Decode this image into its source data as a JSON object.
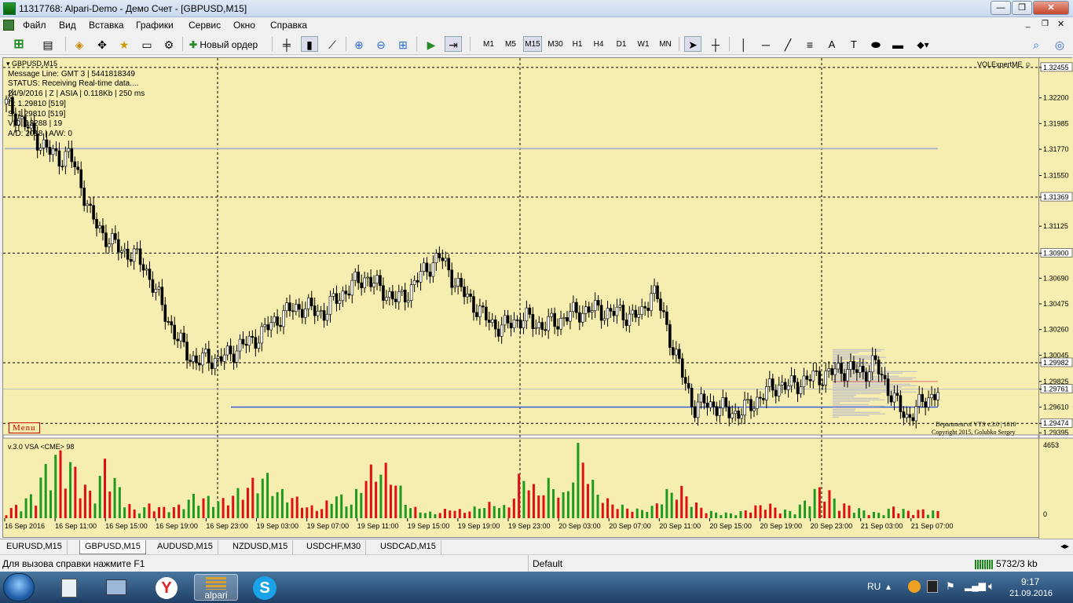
{
  "window": {
    "title": "11317768: Alpari-Demo - Демо Счет - [GBPUSD,M15]"
  },
  "menu": {
    "items": [
      "Файл",
      "Вид",
      "Вставка",
      "Графики",
      "Сервис",
      "Окно",
      "Справка"
    ]
  },
  "toolbar": {
    "new_order": "Новый ордер",
    "timeframes": [
      "M1",
      "M5",
      "M15",
      "M30",
      "H1",
      "H4",
      "D1",
      "W1",
      "MN"
    ],
    "active_timeframe": "M15"
  },
  "chart": {
    "symbol_title": "GBPUSD,M15",
    "info_lines": [
      "Message Line: GMT 3 | 5441818349",
      "STATUS: Receiving Real-time data....",
      "24/9/2016 | Z | ASIA | 0.118Kb | 250 ms",
      "D: 1.29810 [519]",
      "S: 1.29810 [519]",
      "V|D: 12288 | 19",
      "A/D: 2018 | A/W: 0"
    ],
    "expert_label": "VOLExpertME",
    "menu_badge": "Menu",
    "copyright_1": "Department of VTS  v.3.0 | 1010",
    "copyright_2": "Copyright 2015, Golubko Sergey",
    "volume_indicator": "v.3.0 VSA <CME> 98",
    "volume_max": "4653",
    "volume_zero": "0",
    "price_labels": [
      "1.32455",
      "1.32200",
      "1.31985",
      "1.31770",
      "1.31550",
      "1.31369",
      "1.31125",
      "1.30900",
      "1.30690",
      "1.30475",
      "1.30260",
      "1.30045",
      "1.29982",
      "1.29825",
      "1.29761",
      "1.29610",
      "1.29474",
      "1.29395"
    ],
    "highlighted_prices": [
      "1.32455",
      "1.31369",
      "1.30900",
      "1.29982",
      "1.29761",
      "1.29474"
    ],
    "time_labels": [
      "16 Sep 2016",
      "16 Sep 11:00",
      "16 Sep 15:00",
      "16 Sep 19:00",
      "16 Sep 23:00",
      "19 Sep 03:00",
      "19 Sep 07:00",
      "19 Sep 11:00",
      "19 Sep 15:00",
      "19 Sep 19:00",
      "19 Sep 23:00",
      "20 Sep 03:00",
      "20 Sep 07:00",
      "20 Sep 11:00",
      "20 Sep 15:00",
      "20 Sep 19:00",
      "20 Sep 23:00",
      "21 Sep 03:00",
      "21 Sep 07:00"
    ]
  },
  "chart_data": {
    "type": "candlestick",
    "title": "GBPUSD,M15",
    "ylim": [
      1.2939,
      1.3252
    ],
    "x_start": "16 Sep 2016",
    "x_end": "21 Sep 07:00",
    "close_path": [
      1.3215,
      1.3205,
      1.3195,
      1.3185,
      1.3175,
      1.317,
      1.3172,
      1.315,
      1.312,
      1.3108,
      1.3098,
      1.3092,
      1.3088,
      1.308,
      1.306,
      1.304,
      1.302,
      1.3008,
      1.2998,
      1.3003,
      1.3,
      1.3005,
      1.3012,
      1.3015,
      1.3022,
      1.303,
      1.3038,
      1.3043,
      1.3045,
      1.3042,
      1.304,
      1.305,
      1.3058,
      1.3065,
      1.307,
      1.3062,
      1.3056,
      1.305,
      1.3058,
      1.307,
      1.308,
      1.3087,
      1.3072,
      1.3058,
      1.3049,
      1.3038,
      1.303,
      1.3028,
      1.3033,
      1.3036,
      1.303,
      1.303,
      1.3032,
      1.3038,
      1.304,
      1.3043,
      1.3042,
      1.304,
      1.304,
      1.3037,
      1.3038,
      1.306,
      1.304,
      1.301,
      1.2985,
      1.296,
      1.2965,
      1.2962,
      1.2958,
      1.2956,
      1.296,
      1.2968,
      1.2975,
      1.298,
      1.2978,
      1.2982,
      1.2985,
      1.2987,
      1.299,
      1.2993,
      1.2992,
      1.299,
      1.2998,
      1.2982,
      1.2965,
      1.2952,
      1.296,
      1.2968,
      1.2975
    ],
    "volume_path": [
      400,
      900,
      1500,
      3500,
      3800,
      2600,
      1300,
      3500,
      1500,
      400,
      800,
      600,
      700,
      1300,
      1200,
      1000,
      1500,
      2000,
      2600,
      1600,
      1300,
      700,
      600,
      1500,
      800,
      2500,
      3100,
      2600,
      800,
      400,
      300,
      600,
      400,
      700,
      900,
      600,
      2800,
      1500,
      2200,
      1200,
      4400,
      1800,
      1000,
      700,
      500,
      600,
      1500,
      1800,
      900,
      400,
      300,
      300,
      600,
      900,
      500,
      400,
      1300,
      2000,
      900,
      700,
      400,
      300,
      700,
      400,
      500,
      400
    ],
    "horizontal_levels": [
      1.31775,
      1.2961
    ],
    "dashed_levels": [
      1.32455,
      1.31369,
      1.309,
      1.29982,
      1.29474
    ]
  },
  "tabs": [
    "EURUSD,M15",
    "GBPUSD,M15",
    "AUDUSD,M15",
    "NZDUSD,M15",
    "USDCHF,M30",
    "USDCAD,M15"
  ],
  "active_tab": "GBPUSD,M15",
  "status": {
    "help": "Для вызова справки нажмите F1",
    "profile": "Default",
    "traffic": "5732/3 kb"
  },
  "taskbar": {
    "alpari_label": "alpari",
    "lang": "RU",
    "time": "9:17",
    "date": "21.09.2016"
  },
  "colors": {
    "chart_bg": "#f5eeb0",
    "bull_volume": "#1f9a1f",
    "bear_volume": "#e01010",
    "level_line": "#3a5ed8",
    "gray_line": "#b4b4c8"
  }
}
